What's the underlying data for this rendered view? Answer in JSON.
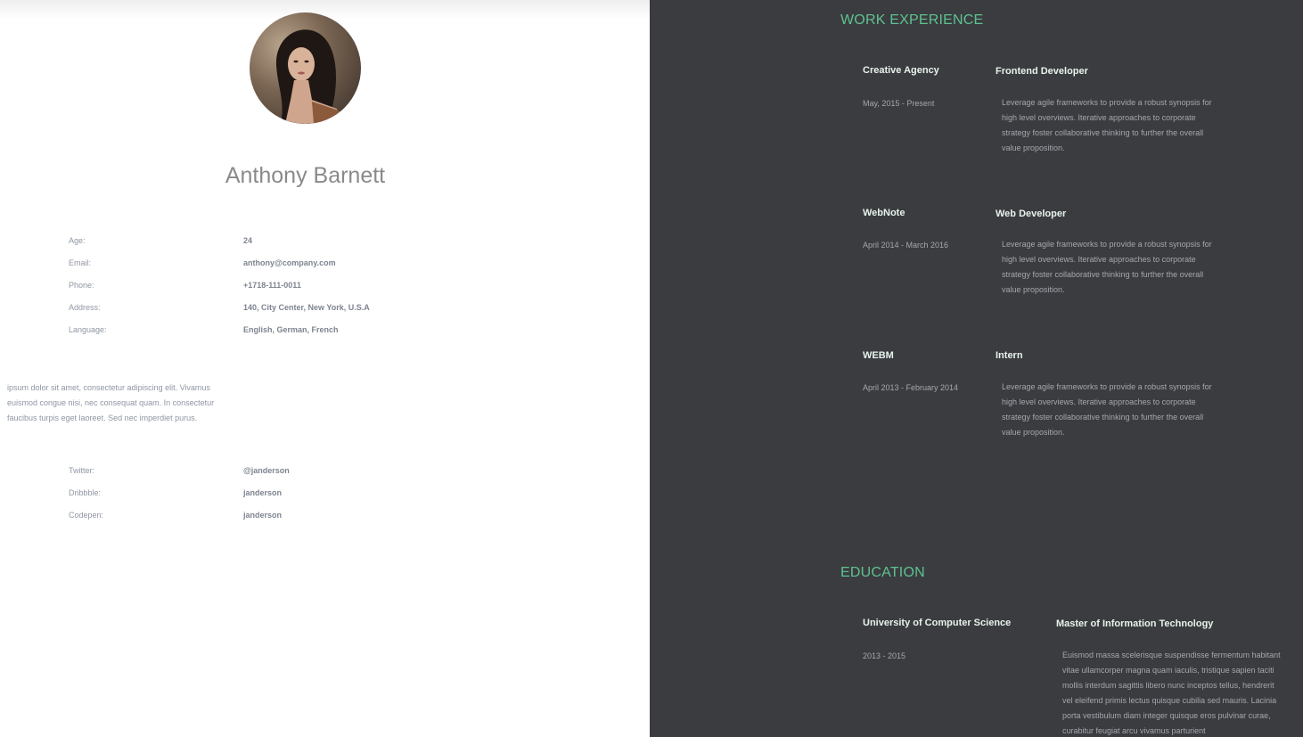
{
  "profile": {
    "name": "Anthony Barnett",
    "photo_alt": "profile-photo"
  },
  "info": [
    {
      "label": "Age:",
      "value": "24"
    },
    {
      "label": "Email:",
      "value": "anthony@company.com"
    },
    {
      "label": "Phone:",
      "value": "+1718-111-0011"
    },
    {
      "label": "Address:",
      "value": "140, City Center, New York, U.S.A"
    },
    {
      "label": "Language:",
      "value": "English, German, French"
    }
  ],
  "bio": "ipsum dolor sit amet, consectetur adipiscing elit. Vivamus euismod congue nisi, nec consequat quam. In consectetur faucibus turpis eget laoreet. Sed nec imperdiet purus.",
  "social": [
    {
      "label": "Twitter:",
      "value": "@janderson"
    },
    {
      "label": "Dribbble:",
      "value": "janderson"
    },
    {
      "label": "Codepen:",
      "value": "janderson"
    }
  ],
  "work": {
    "title": "WORK EXPERIENCE",
    "items": [
      {
        "company": "Creative Agency",
        "role": "Frontend Developer",
        "period": "May, 2015 - Present",
        "description": "Leverage agile frameworks to provide a robust synopsis for high level overviews. Iterative approaches to corporate strategy foster collaborative thinking to further the overall value proposition."
      },
      {
        "company": "WebNote",
        "role": "Web Developer",
        "period": "April 2014 - March 2016",
        "description": "Leverage agile frameworks to provide a robust synopsis for high level overviews. Iterative approaches to corporate strategy foster collaborative thinking to further the overall value proposition."
      },
      {
        "company": "WEBM",
        "role": "Intern",
        "period": "April 2013 - February 2014",
        "description": "Leverage agile frameworks to provide a robust synopsis for high level overviews. Iterative approaches to corporate strategy foster collaborative thinking to further the overall value proposition."
      }
    ]
  },
  "education": {
    "title": "EDUCATION",
    "items": [
      {
        "school": "University of Computer Science",
        "degree": "Master of Information Technology",
        "period": "2013 - 2015",
        "description": "Euismod massa scelerisque suspendisse fermentum habitant vitae ullamcorper magna quam iaculis, tristique sapien taciti mollis interdum sagittis libero nunc inceptos tellus, hendrerit vel eleifend primis lectus quisque cubilia sed mauris. Lacinia porta vestibulum diam integer quisque eros pulvinar curae, curabitur feugiat arcu vivamus parturient"
      }
    ]
  },
  "colors": {
    "accent": "#5ec28f",
    "dark_panel": "#3b3c40",
    "heading_text": "#e7f3eb",
    "muted_text": "#a4a7ad",
    "name_text": "#8a8a8a"
  }
}
